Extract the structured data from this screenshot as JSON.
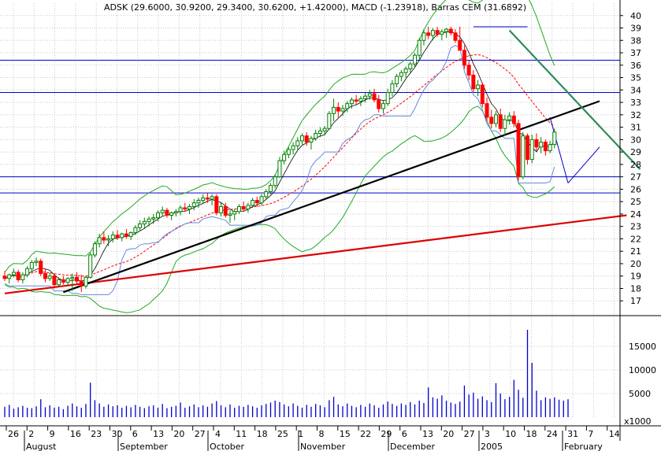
{
  "chart_data": {
    "type": "candlestick",
    "title": "ADSK (29.6000, 30.9200, 29.3400, 30.6200, +1.42000), MACD (-1.23918), Barras CEM (31.6892)",
    "price_axis": {
      "ylim": [
        16,
        41
      ],
      "ticks": [
        "17",
        "18",
        "19",
        "20",
        "21",
        "22",
        "23",
        "24",
        "25",
        "26",
        "27",
        "28",
        "29",
        "30",
        "31",
        "32",
        "33",
        "34",
        "35",
        "36",
        "37",
        "38",
        "39",
        "40"
      ]
    },
    "volume_axis": {
      "ylim": [
        0,
        20000
      ],
      "ticks": [
        "5000",
        "10000",
        "15000"
      ],
      "unit_label": "x1000"
    },
    "x_axis": {
      "day_labels": [
        "26",
        "2",
        "9",
        "16",
        "23",
        "30",
        "6",
        "13",
        "20",
        "27",
        "4",
        "11",
        "18",
        "25",
        "1",
        "8",
        "15",
        "22",
        "29",
        "6",
        "13",
        "20",
        "27",
        "3",
        "10",
        "18",
        "24",
        "31",
        "7",
        "14"
      ],
      "month_labels": [
        "August",
        "September",
        "October",
        "November",
        "December",
        "2005",
        "February"
      ]
    },
    "horizontal_lines": [
      36.4,
      33.8,
      27.0,
      25.7
    ],
    "colors": {
      "up": "#008000",
      "down": "#ff0000",
      "grid": "#c8c8c8",
      "hline": "#0000cc",
      "volume": "#0000cc",
      "band": "#22aa22",
      "ma_red": "#ff0000",
      "ma_blue": "#6688dd",
      "trend_red": "#dd0000",
      "trend_black": "#000000",
      "trend_teal": "#2e8b57"
    },
    "trendlines": [
      {
        "color": "trend_red",
        "from": [
          0,
          17.6
        ],
        "to": [
          138,
          23.9
        ]
      },
      {
        "color": "trend_black",
        "from": [
          13,
          17.7
        ],
        "to": [
          132,
          33.1
        ]
      },
      {
        "color": "trend_teal",
        "from": [
          112,
          38.8
        ],
        "to": [
          141,
          27.6
        ]
      }
    ],
    "small_lines": [
      {
        "from": [
          125,
          26.5
        ],
        "to": [
          132,
          29.4
        ]
      },
      {
        "from": [
          125,
          26.5
        ],
        "to": [
          121,
          31.8
        ]
      },
      {
        "from": [
          104,
          39.1
        ],
        "to": [
          116,
          39.1
        ]
      }
    ],
    "candles": [
      [
        19.0,
        19.4,
        18.6,
        18.8
      ],
      [
        18.8,
        19.2,
        18.4,
        19.1
      ],
      [
        19.1,
        19.6,
        18.9,
        19.3
      ],
      [
        19.3,
        19.5,
        18.5,
        18.7
      ],
      [
        18.7,
        19.3,
        18.4,
        19.1
      ],
      [
        19.1,
        19.8,
        18.9,
        19.6
      ],
      [
        19.6,
        20.3,
        19.4,
        20.1
      ],
      [
        20.1,
        20.5,
        19.8,
        20.2
      ],
      [
        20.2,
        20.4,
        19.0,
        19.2
      ],
      [
        19.2,
        19.6,
        18.5,
        18.8
      ],
      [
        18.8,
        19.3,
        18.6,
        19.0
      ],
      [
        19.0,
        19.2,
        18.0,
        18.3
      ],
      [
        18.3,
        18.9,
        18.1,
        18.7
      ],
      [
        18.7,
        19.0,
        18.3,
        18.5
      ],
      [
        18.5,
        18.9,
        18.2,
        18.8
      ],
      [
        18.8,
        19.2,
        17.8,
        18.9
      ],
      [
        18.9,
        19.3,
        18.4,
        18.6
      ],
      [
        18.6,
        19.1,
        17.7,
        18.2
      ],
      [
        18.2,
        19.0,
        18.0,
        18.9
      ],
      [
        18.9,
        20.9,
        18.8,
        20.7
      ],
      [
        20.7,
        21.8,
        20.5,
        21.6
      ],
      [
        21.6,
        22.4,
        21.3,
        22.1
      ],
      [
        22.1,
        22.6,
        21.6,
        21.9
      ],
      [
        21.9,
        22.3,
        21.4,
        22.0
      ],
      [
        22.0,
        22.6,
        21.7,
        22.3
      ],
      [
        22.3,
        22.7,
        21.9,
        22.1
      ],
      [
        22.1,
        22.5,
        21.8,
        22.4
      ],
      [
        22.4,
        22.8,
        22.0,
        22.2
      ],
      [
        22.2,
        22.6,
        21.9,
        22.5
      ],
      [
        22.5,
        23.1,
        22.3,
        22.9
      ],
      [
        22.9,
        23.5,
        22.6,
        23.2
      ],
      [
        23.2,
        23.7,
        22.8,
        23.4
      ],
      [
        23.4,
        23.8,
        23.0,
        23.6
      ],
      [
        23.6,
        24.0,
        23.2,
        23.7
      ],
      [
        23.7,
        24.3,
        23.4,
        24.1
      ],
      [
        24.1,
        24.6,
        23.8,
        24.3
      ],
      [
        24.3,
        24.5,
        23.7,
        23.9
      ],
      [
        23.9,
        24.2,
        23.5,
        24.1
      ],
      [
        24.1,
        24.4,
        23.8,
        24.2
      ],
      [
        24.2,
        24.7,
        23.9,
        24.5
      ],
      [
        24.5,
        24.9,
        24.2,
        24.4
      ],
      [
        24.4,
        24.8,
        24.0,
        24.6
      ],
      [
        24.6,
        25.2,
        24.3,
        24.9
      ],
      [
        24.9,
        25.3,
        24.5,
        25.1
      ],
      [
        25.1,
        25.6,
        24.8,
        25.3
      ],
      [
        25.3,
        25.7,
        24.9,
        25.2
      ],
      [
        25.2,
        25.6,
        24.7,
        25.4
      ],
      [
        25.4,
        25.6,
        23.9,
        24.1
      ],
      [
        24.1,
        24.9,
        23.8,
        24.6
      ],
      [
        24.6,
        24.9,
        23.7,
        23.9
      ],
      [
        23.9,
        24.3,
        23.3,
        24.0
      ],
      [
        24.0,
        24.4,
        23.5,
        24.2
      ],
      [
        24.2,
        24.8,
        24.0,
        24.6
      ],
      [
        24.6,
        25.0,
        24.2,
        24.4
      ],
      [
        24.4,
        24.9,
        24.1,
        24.7
      ],
      [
        24.7,
        25.3,
        24.5,
        25.1
      ],
      [
        25.1,
        25.4,
        24.6,
        24.9
      ],
      [
        24.9,
        25.6,
        24.7,
        25.4
      ],
      [
        25.4,
        26.0,
        25.2,
        25.8
      ],
      [
        25.8,
        26.5,
        25.6,
        26.3
      ],
      [
        26.3,
        27.2,
        26.1,
        27.0
      ],
      [
        27.0,
        28.6,
        26.9,
        28.3
      ],
      [
        28.3,
        29.1,
        28.0,
        28.8
      ],
      [
        28.8,
        29.4,
        28.5,
        29.2
      ],
      [
        29.2,
        29.8,
        28.8,
        29.5
      ],
      [
        29.5,
        30.2,
        29.2,
        29.9
      ],
      [
        29.9,
        30.5,
        29.6,
        30.3
      ],
      [
        30.3,
        30.6,
        29.5,
        29.8
      ],
      [
        29.8,
        30.3,
        29.2,
        30.1
      ],
      [
        30.1,
        30.8,
        29.9,
        30.5
      ],
      [
        30.5,
        31.0,
        30.2,
        30.7
      ],
      [
        30.7,
        31.1,
        30.4,
        30.9
      ],
      [
        30.9,
        32.3,
        30.8,
        32.1
      ],
      [
        32.1,
        33.3,
        31.5,
        32.6
      ],
      [
        32.6,
        33.0,
        31.8,
        32.3
      ],
      [
        32.3,
        32.8,
        31.9,
        32.5
      ],
      [
        32.5,
        33.1,
        32.2,
        32.9
      ],
      [
        32.9,
        33.4,
        32.5,
        33.2
      ],
      [
        33.2,
        33.6,
        32.8,
        33.1
      ],
      [
        33.1,
        33.5,
        32.7,
        33.3
      ],
      [
        33.3,
        33.8,
        33.0,
        33.5
      ],
      [
        33.5,
        34.0,
        33.2,
        33.7
      ],
      [
        33.7,
        34.1,
        33.0,
        33.2
      ],
      [
        33.2,
        33.6,
        32.2,
        32.5
      ],
      [
        32.5,
        33.2,
        32.1,
        32.9
      ],
      [
        32.9,
        34.1,
        32.7,
        33.8
      ],
      [
        33.8,
        34.8,
        33.5,
        34.5
      ],
      [
        34.5,
        35.3,
        34.2,
        35.1
      ],
      [
        35.1,
        35.6,
        34.7,
        35.4
      ],
      [
        35.4,
        35.9,
        35.0,
        35.7
      ],
      [
        35.7,
        36.3,
        35.4,
        36.1
      ],
      [
        36.1,
        37.0,
        35.8,
        36.8
      ],
      [
        36.8,
        38.2,
        36.5,
        38.0
      ],
      [
        38.0,
        38.9,
        37.6,
        38.6
      ],
      [
        38.6,
        39.1,
        38.1,
        38.4
      ],
      [
        38.4,
        39.0,
        38.0,
        38.8
      ],
      [
        38.8,
        39.1,
        38.3,
        38.5
      ],
      [
        38.5,
        38.9,
        38.0,
        38.7
      ],
      [
        38.7,
        39.0,
        38.2,
        38.9
      ],
      [
        38.9,
        39.1,
        38.4,
        38.6
      ],
      [
        38.6,
        38.9,
        37.8,
        38.0
      ],
      [
        38.0,
        39.1,
        37.6,
        37.2
      ],
      [
        37.2,
        37.6,
        35.7,
        36.0
      ],
      [
        36.0,
        36.4,
        34.8,
        35.2
      ],
      [
        35.2,
        35.6,
        33.8,
        34.1
      ],
      [
        34.1,
        34.8,
        33.5,
        34.4
      ],
      [
        34.4,
        34.6,
        32.6,
        32.9
      ],
      [
        32.9,
        33.4,
        31.5,
        31.8
      ],
      [
        31.8,
        32.4,
        30.9,
        31.3
      ],
      [
        31.3,
        32.3,
        31.0,
        32.0
      ],
      [
        32.0,
        32.5,
        30.6,
        30.9
      ],
      [
        30.9,
        32.0,
        30.3,
        31.6
      ],
      [
        31.6,
        32.2,
        31.2,
        31.9
      ],
      [
        31.9,
        32.3,
        31.0,
        31.3
      ],
      [
        31.3,
        31.6,
        26.7,
        27.0
      ],
      [
        27.0,
        30.6,
        26.8,
        30.3
      ],
      [
        30.3,
        30.5,
        28.0,
        28.4
      ],
      [
        28.4,
        30.4,
        28.1,
        30.0
      ],
      [
        30.0,
        30.5,
        29.1,
        29.4
      ],
      [
        29.4,
        30.2,
        28.9,
        29.8
      ],
      [
        29.8,
        30.0,
        28.7,
        29.1
      ],
      [
        29.1,
        29.9,
        28.9,
        29.6
      ],
      [
        29.6,
        30.9,
        29.3,
        30.6
      ]
    ],
    "volume": [
      2200,
      2600,
      1800,
      2100,
      2400,
      2000,
      1900,
      2300,
      3800,
      2100,
      2500,
      2000,
      2200,
      1700,
      2400,
      2900,
      2300,
      2000,
      2800,
      7300,
      3600,
      2900,
      2200,
      2700,
      2300,
      2500,
      2000,
      2400,
      2100,
      2600,
      2200,
      1900,
      2300,
      2500,
      2000,
      2800,
      1900,
      2200,
      2400,
      3100,
      2000,
      2300,
      2700,
      2100,
      2500,
      2200,
      2900,
      3400,
      2500,
      2100,
      2700,
      2000,
      2400,
      2200,
      2600,
      2300,
      2000,
      2500,
      2800,
      3100,
      3500,
      3200,
      2700,
      2300,
      2900,
      2400,
      2000,
      2600,
      2200,
      2800,
      2500,
      2100,
      3600,
      4300,
      2700,
      2300,
      2900,
      2400,
      2100,
      2600,
      2200,
      2900,
      2500,
      2000,
      2700,
      3300,
      2800,
      2400,
      2900,
      2600,
      3200,
      2700,
      3500,
      3000,
      6300,
      4200,
      3900,
      4600,
      3500,
      3100,
      2800,
      3300,
      6700,
      4800,
      5200,
      3900,
      4400,
      3600,
      3200,
      7200,
      5000,
      3800,
      4300,
      7900,
      5800,
      4100,
      18500,
      11500,
      5600,
      3600,
      4200,
      3900,
      4200,
      3700,
      3500,
      3800
    ]
  }
}
